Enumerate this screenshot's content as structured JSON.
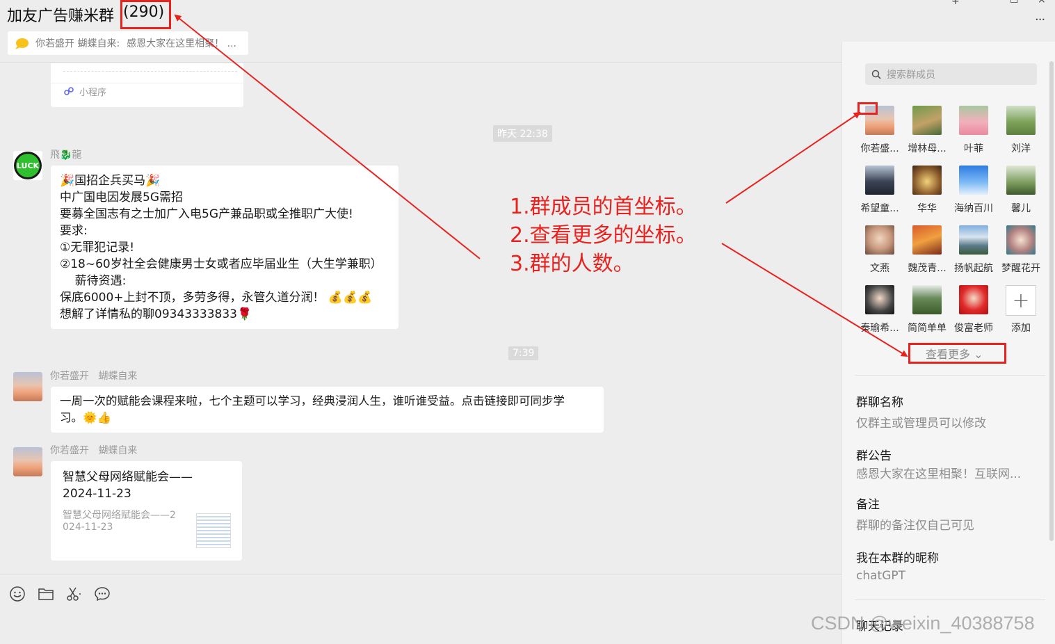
{
  "header": {
    "title": "加友广告赚米群",
    "member_count": "(290)",
    "pinned_sender": "你若盛开  蝴蝶自来:",
    "pinned_text": "感恩大家在这里相聚！ ..."
  },
  "window_controls": {
    "maximize": "☐",
    "close": "×",
    "more": "···"
  },
  "messages": {
    "mini_program_label": "小程序",
    "time1": "昨天 22:38",
    "msg1": {
      "sender": "飛🐉龍",
      "avatar_text": "LUCK",
      "lines": [
        "🎉国招企兵买马🎉",
        "中广国电因发展5G需招",
        "要募全国志有之士加广入电5G产兼品职或全推职广大使!",
        "要求:",
        "①无罪犯记录!",
        "②18~60岁社全会健康男士女或者应毕届业生（大生学兼职）",
        "    薪待资遇:",
        "保底6000+上封不顶，多劳多得，永管久道分润！ 💰💰💰",
        "想解了详情私的聊09343333833🌹"
      ]
    },
    "time2": "7:39",
    "msg2": {
      "sender": "你若盛开   蝴蝶自来",
      "lines": [
        "一周一次的赋能会课程来啦，七个主题可以学习，经典浸润人生，谁听谁受益。点击链接即可同步学",
        "习。🌞👍"
      ]
    },
    "msg3": {
      "sender": "你若盛开   蝴蝶自来",
      "card_title_1": "智慧父母网络赋能会——",
      "card_title_2": "2024-11-23",
      "card_desc_1": "智慧父母网络赋能会——2",
      "card_desc_2": "024-11-23"
    }
  },
  "toolbar": {
    "emoji": "emoji-icon",
    "file": "folder-icon",
    "screenshot": "scissors-icon",
    "chat": "chat-bubble-icon"
  },
  "panel": {
    "search_placeholder": "搜索群成员",
    "members": [
      "你若盛...",
      "增林母...",
      "叶菲",
      "刘洋",
      "希望童...",
      "华华",
      "海纳百川",
      "馨儿",
      "文燕",
      "魏茂青...",
      "扬帆起航",
      "梦醒花开",
      "秦瑜希...",
      "简简单单",
      "俊富老师"
    ],
    "add_label": "添加",
    "add_symbol": "+",
    "view_more": "查看更多 ⌄",
    "group_name_label": "群聊名称",
    "group_name_value": "仅群主或管理员可以修改",
    "notice_label": "群公告",
    "notice_value": "感恩大家在这里相聚！互联网...",
    "remark_label": "备注",
    "remark_value": "群聊的备注仅自己可见",
    "nickname_label": "我在本群的昵称",
    "nickname_value": "chatGPT",
    "history_label": "聊天记录"
  },
  "annotation": {
    "line1": "1.群成员的首坐标。",
    "line2": "2.查看更多的坐标。",
    "line3": "3.群的人数。"
  },
  "watermark": "CSDN @weixin_40388758",
  "colors": {
    "annotation_red": "#e8231f",
    "panel_bg": "#f5f5f5",
    "chat_bg": "#ededed"
  }
}
